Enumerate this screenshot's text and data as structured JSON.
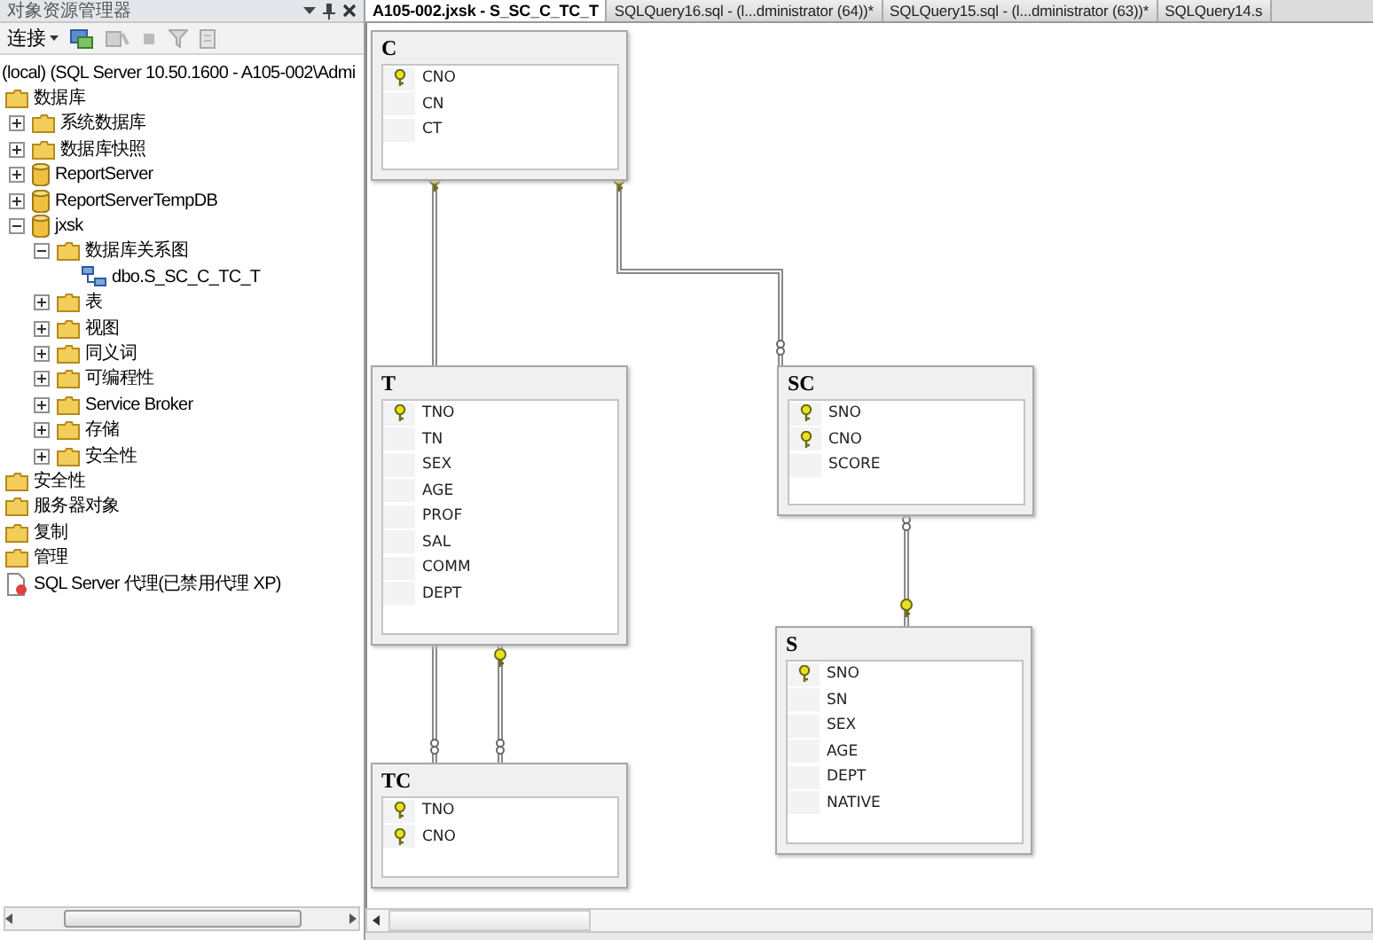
{
  "object_explorer": {
    "title": "对象资源管理器",
    "toolbar": {
      "connect": "连接"
    },
    "tree": [
      {
        "label": "(local) (SQL Server 10.50.1600 - A105-002\\Admi",
        "children": [
          {
            "label": "数据库",
            "kind": "folder",
            "children": [
              {
                "label": "系统数据库",
                "kind": "folder",
                "expanded": false
              },
              {
                "label": "数据库快照",
                "kind": "folder",
                "expanded": false
              },
              {
                "label": "ReportServer",
                "kind": "database",
                "expanded": false
              },
              {
                "label": "ReportServerTempDB",
                "kind": "database",
                "expanded": false
              },
              {
                "label": "jxsk",
                "kind": "database",
                "expanded": true,
                "children": [
                  {
                    "label": "数据库关系图",
                    "kind": "folder",
                    "expanded": true,
                    "children": [
                      {
                        "label": "dbo.S_SC_C_TC_T",
                        "kind": "diagram"
                      }
                    ]
                  },
                  {
                    "label": "表",
                    "kind": "folder",
                    "expanded": false
                  },
                  {
                    "label": "视图",
                    "kind": "folder",
                    "expanded": false
                  },
                  {
                    "label": "同义词",
                    "kind": "folder",
                    "expanded": false
                  },
                  {
                    "label": "可编程性",
                    "kind": "folder",
                    "expanded": false
                  },
                  {
                    "label": "Service Broker",
                    "kind": "folder",
                    "expanded": false
                  },
                  {
                    "label": "存储",
                    "kind": "folder",
                    "expanded": false
                  },
                  {
                    "label": "安全性",
                    "kind": "folder",
                    "expanded": false
                  }
                ]
              }
            ]
          },
          {
            "label": "安全性",
            "kind": "folder"
          },
          {
            "label": "服务器对象",
            "kind": "folder"
          },
          {
            "label": "复制",
            "kind": "folder"
          },
          {
            "label": "管理",
            "kind": "folder"
          },
          {
            "label": "SQL Server 代理(已禁用代理 XP)",
            "kind": "agent"
          }
        ]
      }
    ]
  },
  "tabs": [
    {
      "label": "A105-002.jxsk - S_SC_C_TC_T",
      "selected": true
    },
    {
      "label": "SQLQuery16.sql - (l...dministrator (64))*",
      "selected": false
    },
    {
      "label": "SQLQuery15.sql - (l...dministrator (63))*",
      "selected": false
    },
    {
      "label": "SQLQuery14.s",
      "selected": false
    }
  ],
  "diagram": {
    "tables": [
      {
        "name": "C",
        "columns": [
          {
            "name": "CNO",
            "primary_key": true
          },
          {
            "name": "CN",
            "primary_key": false
          },
          {
            "name": "CT",
            "primary_key": false
          }
        ]
      },
      {
        "name": "T",
        "columns": [
          {
            "name": "TNO",
            "primary_key": true
          },
          {
            "name": "TN",
            "primary_key": false
          },
          {
            "name": "SEX",
            "primary_key": false
          },
          {
            "name": "AGE",
            "primary_key": false
          },
          {
            "name": "PROF",
            "primary_key": false
          },
          {
            "name": "SAL",
            "primary_key": false
          },
          {
            "name": "COMM",
            "primary_key": false
          },
          {
            "name": "DEPT",
            "primary_key": false
          }
        ]
      },
      {
        "name": "TC",
        "columns": [
          {
            "name": "TNO",
            "primary_key": true
          },
          {
            "name": "CNO",
            "primary_key": true
          }
        ]
      },
      {
        "name": "SC",
        "columns": [
          {
            "name": "SNO",
            "primary_key": true
          },
          {
            "name": "CNO",
            "primary_key": true
          },
          {
            "name": "SCORE",
            "primary_key": false
          }
        ]
      },
      {
        "name": "S",
        "columns": [
          {
            "name": "SNO",
            "primary_key": true
          },
          {
            "name": "SN",
            "primary_key": false
          },
          {
            "name": "SEX",
            "primary_key": false
          },
          {
            "name": "AGE",
            "primary_key": false
          },
          {
            "name": "DEPT",
            "primary_key": false
          },
          {
            "name": "NATIVE",
            "primary_key": false
          }
        ]
      }
    ]
  }
}
